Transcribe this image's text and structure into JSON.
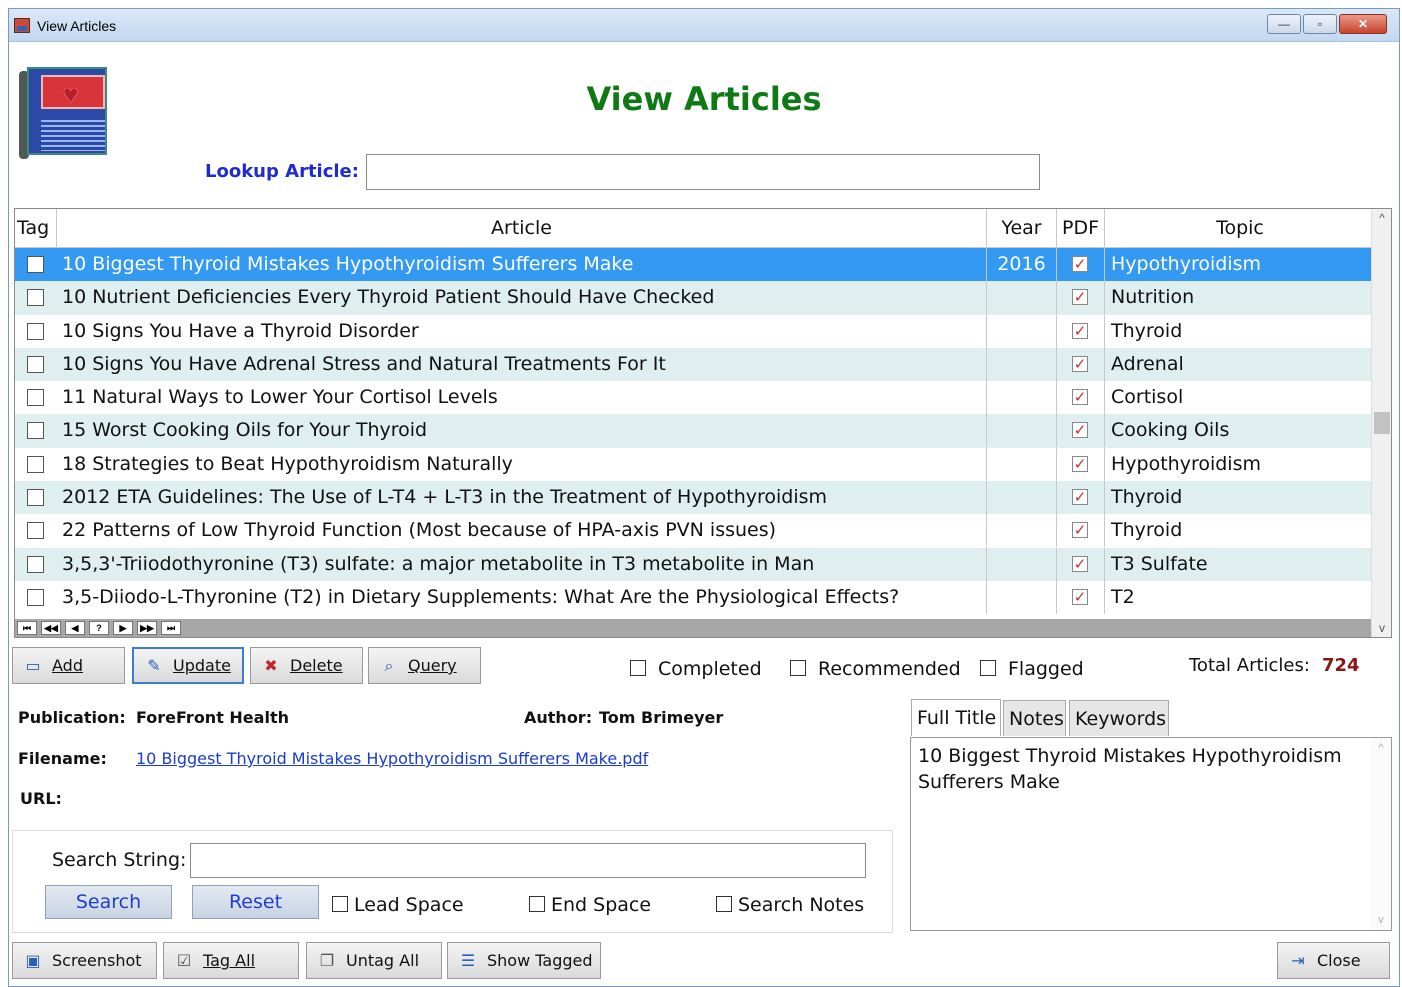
{
  "window": {
    "title": "View Articles",
    "min": "—",
    "max": "▫",
    "close": "✕"
  },
  "header": {
    "title": "View Articles",
    "lookup_label": "Lookup Article:",
    "lookup_value": ""
  },
  "grid": {
    "columns": [
      "Tag",
      "Article",
      "Year",
      "PDF",
      "Topic"
    ],
    "rows": [
      {
        "tag": false,
        "article": "10 Biggest Thyroid Mistakes Hypothyroidism Sufferers Make",
        "year": "2016",
        "pdf": true,
        "topic": "Hypothyroidism",
        "selected": true
      },
      {
        "tag": false,
        "article": "10 Nutrient Deficiencies Every Thyroid Patient Should Have Checked",
        "year": "",
        "pdf": true,
        "topic": "Nutrition"
      },
      {
        "tag": false,
        "article": "10 Signs You Have a Thyroid Disorder",
        "year": "",
        "pdf": true,
        "topic": "Thyroid"
      },
      {
        "tag": false,
        "article": "10 Signs You Have Adrenal Stress and Natural Treatments For It",
        "year": "",
        "pdf": true,
        "topic": "Adrenal"
      },
      {
        "tag": false,
        "article": "11 Natural Ways to Lower Your Cortisol Levels",
        "year": "",
        "pdf": true,
        "topic": "Cortisol"
      },
      {
        "tag": false,
        "article": "15 Worst Cooking Oils for Your Thyroid",
        "year": "",
        "pdf": true,
        "topic": "Cooking Oils"
      },
      {
        "tag": false,
        "article": "18 Strategies to Beat Hypothyroidism Naturally",
        "year": "",
        "pdf": true,
        "topic": "Hypothyroidism"
      },
      {
        "tag": false,
        "article": "2012 ETA Guidelines: The Use of L-T4 + L-T3 in the Treatment of Hypothyroidism",
        "year": "",
        "pdf": true,
        "topic": "Thyroid"
      },
      {
        "tag": false,
        "article": "22 Patterns of Low Thyroid Function (Most because of HPA-axis PVN issues)",
        "year": "",
        "pdf": true,
        "topic": "Thyroid"
      },
      {
        "tag": false,
        "article": "3,5,3'-Triiodothyronine (T3) sulfate: a major metabolite in T3 metabolite in Man",
        "year": "",
        "pdf": true,
        "topic": "T3 Sulfate"
      },
      {
        "tag": false,
        "article": "3,5-Diiodo-L-Thyronine (T2) in Dietary Supplements: What Are the Physiological Effects?",
        "year": "",
        "pdf": true,
        "topic": "T2"
      }
    ],
    "nav": [
      "⏮",
      "◀◀",
      "◀",
      "?",
      "▶",
      "▶▶",
      "⏭"
    ],
    "check_glyph": "✓",
    "scroll_up": "^",
    "scroll_down": "v"
  },
  "actions": {
    "add": "Add",
    "update": "Update",
    "delete": "Delete",
    "query": "Query"
  },
  "filters": {
    "completed": "Completed",
    "recommended": "Recommended",
    "flagged": "Flagged"
  },
  "totals": {
    "label": "Total Articles:",
    "value": "724"
  },
  "details": {
    "publication_label": "Publication:",
    "publication": "ForeFront Health",
    "author_label": "Author:",
    "author": "Tom Brimeyer",
    "filename_label": "Filename:",
    "filename": "10 Biggest Thyroid Mistakes Hypothyroidism Sufferers Make.pdf",
    "url_label": "URL:"
  },
  "tabs": {
    "items": [
      "Full Title",
      "Notes",
      "Keywords"
    ],
    "content": "10 Biggest Thyroid Mistakes Hypothyroidism Sufferers Make"
  },
  "search": {
    "label": "Search String:",
    "value": "",
    "search": "Search",
    "reset": "Reset",
    "lead_space": "Lead Space",
    "end_space": "End Space",
    "search_notes": "Search Notes"
  },
  "bottom": {
    "screenshot": "Screenshot",
    "tag_all": "Tag All",
    "untag_all": "Untag All",
    "show_tagged": "Show Tagged",
    "close": "Close"
  },
  "icons": {
    "add": "add-icon",
    "update": "update-icon",
    "delete": "delete-icon",
    "query": "query-icon"
  }
}
